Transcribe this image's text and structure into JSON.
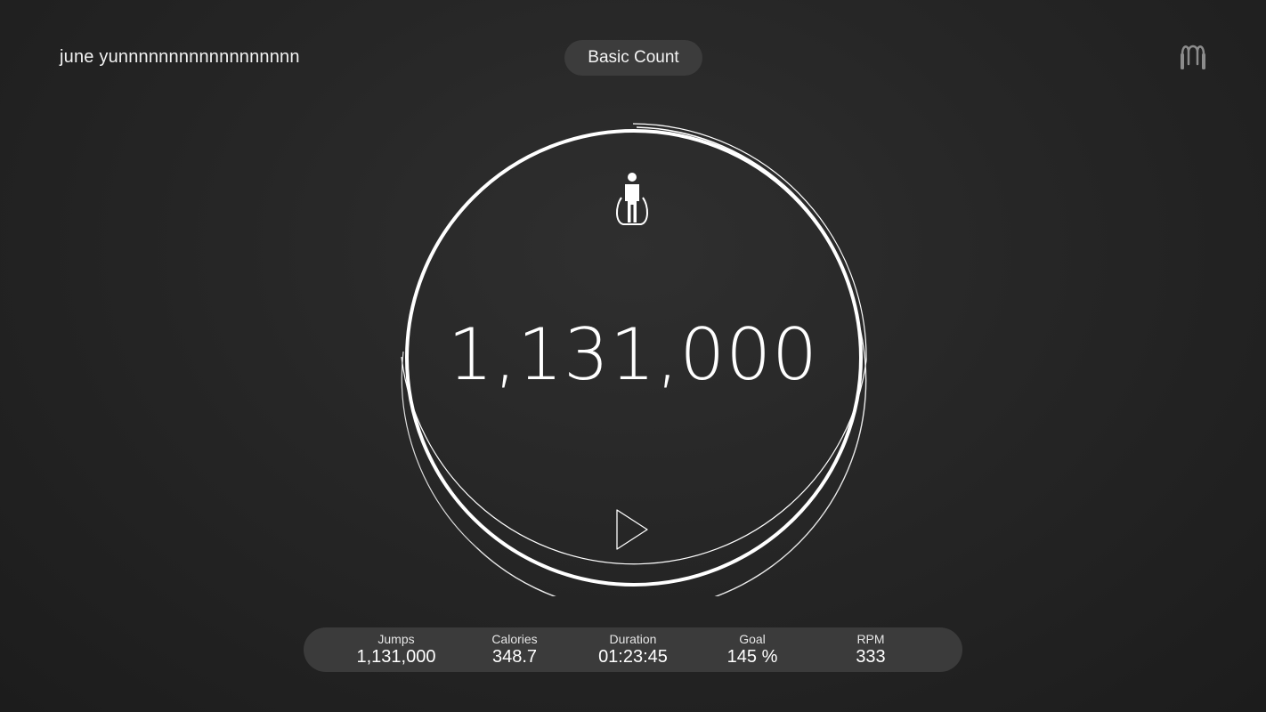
{
  "header": {
    "user_name": "june yunnnnnnnnnnnnnnnnnn",
    "mode_label": "Basic Count",
    "logo_icon": "jump-rope-logo-icon"
  },
  "dial": {
    "mode_icon": "person-jump-rope-icon",
    "count": "1,131,000",
    "play_icon": "play-icon",
    "progress_ring_color": "#ffffff"
  },
  "stats": [
    {
      "label": "Jumps",
      "value": "1,131,000"
    },
    {
      "label": "Calories",
      "value": "348.7"
    },
    {
      "label": "Duration",
      "value": "01:23:45"
    },
    {
      "label": "Goal",
      "value": "145 %"
    },
    {
      "label": "RPM",
      "value": "333"
    }
  ],
  "colors": {
    "background": "#262626",
    "pill": "#3c3c3c",
    "text": "#ffffff"
  }
}
